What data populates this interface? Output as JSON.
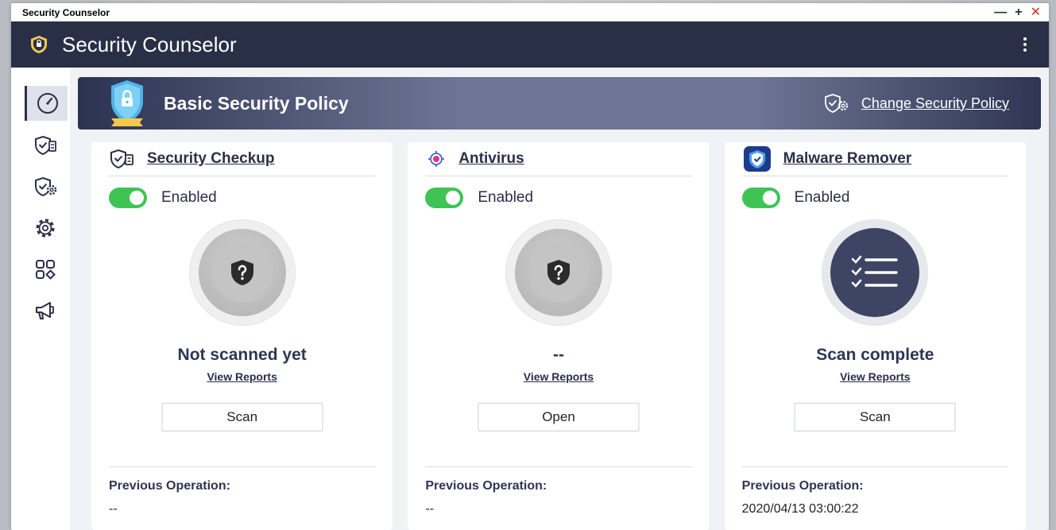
{
  "window": {
    "title": "Security Counselor",
    "controls": [
      "—",
      "+",
      "✕"
    ]
  },
  "app": {
    "name": "Security Counselor"
  },
  "sidebar": {
    "items": [
      {
        "name": "dashboard",
        "icon": "gauge-icon",
        "active": true
      },
      {
        "name": "security-checkup",
        "icon": "shield-checklist-icon"
      },
      {
        "name": "security-policy",
        "icon": "shield-gear-icon"
      },
      {
        "name": "settings",
        "icon": "gear-icon"
      },
      {
        "name": "apps",
        "icon": "apps-grid-icon"
      },
      {
        "name": "announcements",
        "icon": "megaphone-icon"
      }
    ]
  },
  "policy": {
    "name": "Basic Security Policy",
    "change_label": "Change Security Policy"
  },
  "cards": [
    {
      "title": "Security Checkup",
      "icon": "shield-checklist-icon",
      "toggle_label": "Enabled",
      "status": "Not scanned yet",
      "reports_label": "View Reports",
      "button_label": "Scan",
      "prev_label": "Previous Operation:",
      "prev_value": "--"
    },
    {
      "title": "Antivirus",
      "icon": "antivirus-icon",
      "toggle_label": "Enabled",
      "status": "--",
      "reports_label": "View Reports",
      "button_label": "Open",
      "prev_label": "Previous Operation:",
      "prev_value": "--"
    },
    {
      "title": "Malware Remover",
      "icon": "malware-remover-icon",
      "toggle_label": "Enabled",
      "status": "Scan complete",
      "reports_label": "View Reports",
      "button_label": "Scan",
      "prev_label": "Previous Operation:",
      "prev_value": "2020/04/13 03:00:22"
    }
  ],
  "colors": {
    "appbar": "#2a2f48",
    "toggle_on": "#3fc454",
    "close": "#e0241b"
  }
}
